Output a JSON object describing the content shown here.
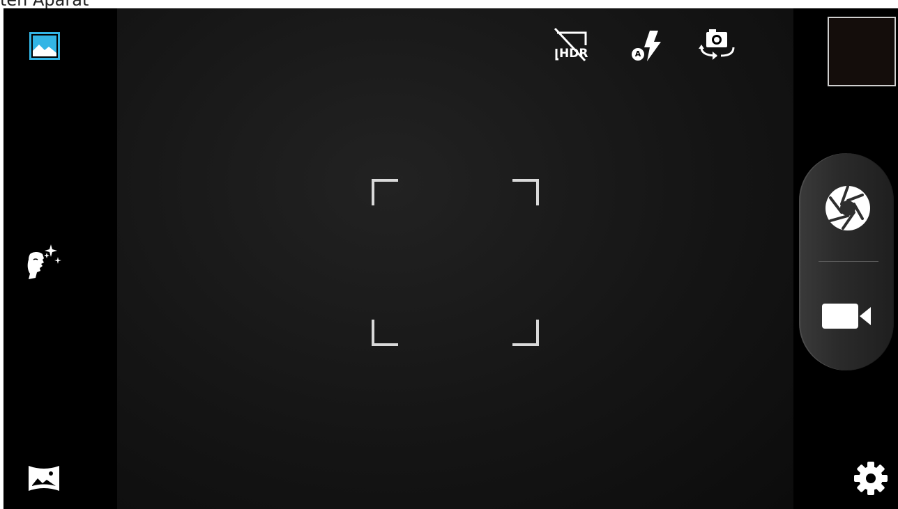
{
  "app": {
    "title": "ten Aparat"
  },
  "left_toolbar": {
    "gallery_icon": "gallery-icon",
    "beauty_icon": "beauty-face-icon",
    "panorama_icon": "panorama-icon"
  },
  "top_toolbar": {
    "hdr": {
      "icon": "hdr-off-icon",
      "label": "HDR"
    },
    "flash": {
      "icon": "flash-auto-icon",
      "badge": "A"
    },
    "switch_camera_icon": "switch-camera-icon"
  },
  "right_panel": {
    "thumbnail_icon": "last-photo-thumbnail",
    "shutter_icon": "shutter-icon",
    "video_icon": "video-camera-icon",
    "settings_icon": "gear-icon"
  },
  "colors": {
    "accent": "#33b5e5",
    "icon": "#ffffff",
    "focus_frame": "#d9d9d9"
  }
}
